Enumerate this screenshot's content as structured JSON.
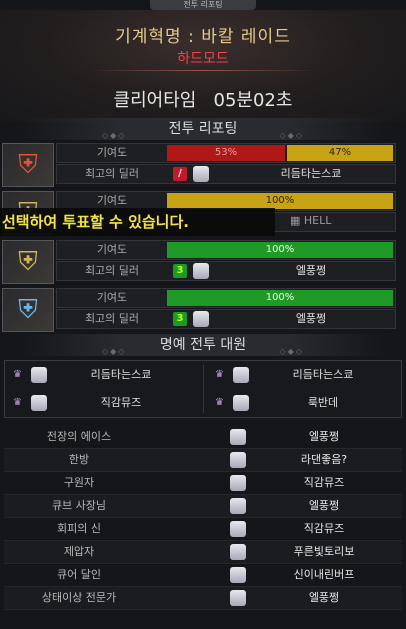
{
  "window": {
    "title": "전투 리포팅"
  },
  "header": {
    "raid_title": "기계혁명 : 바칼 레이드",
    "mode": "하드모드",
    "clear_time_label": "클리어타임",
    "clear_time": "05분02초"
  },
  "sections": {
    "report": "전투 리포팅",
    "honor": "명예 전투 대원"
  },
  "labels": {
    "contribution": "기여도",
    "top_dealer": "최고의 딜러"
  },
  "members": [
    {
      "portrait_icon": "red-armor-icon",
      "bars": [
        {
          "color": "#b01818",
          "label": "53%",
          "fraction": 0.53
        },
        {
          "color": "#c9a316",
          "label": "47%",
          "fraction": 0.47
        }
      ],
      "dealer_badge": "/",
      "dealer_name": "리듬타는스쿄"
    },
    {
      "portrait_icon": "gold-armor-icon",
      "bars": [
        {
          "color": "#c9a316",
          "label": "100%",
          "fraction": 1.0
        }
      ],
      "dealer_note": "HELL"
    },
    {
      "portrait_icon": "gold-armor-icon",
      "bars": [
        {
          "color": "#1f9a26",
          "label": "100%",
          "fraction": 1.0
        }
      ],
      "dealer_badge": "3",
      "dealer_name": "엘풍쩡"
    },
    {
      "portrait_icon": "blue-armor-icon",
      "bars": [
        {
          "color": "#1f9a26",
          "label": "100%",
          "fraction": 1.0
        }
      ],
      "dealer_badge": "3",
      "dealer_name": "엘풍쩡"
    }
  ],
  "vote_banner": "선택하여 투표할 수 있습니다.",
  "honor": [
    "리듬타는스쿄",
    "리듬타는스쿄",
    "직감뮤즈",
    "룩반데"
  ],
  "awards": [
    {
      "title": "전장의 에이스",
      "winner": "엘풍쩡"
    },
    {
      "title": "한방",
      "winner": "라댄좋음?"
    },
    {
      "title": "구원자",
      "winner": "직감뮤즈"
    },
    {
      "title": "큐브 사장님",
      "winner": "엘풍쩡"
    },
    {
      "title": "회피의 신",
      "winner": "직감뮤즈"
    },
    {
      "title": "제압자",
      "winner": "푸른빛토리보"
    },
    {
      "title": "큐어 달인",
      "winner": "신이내린버프"
    },
    {
      "title": "상태이상 전문가",
      "winner": "엘풍쩡"
    }
  ]
}
